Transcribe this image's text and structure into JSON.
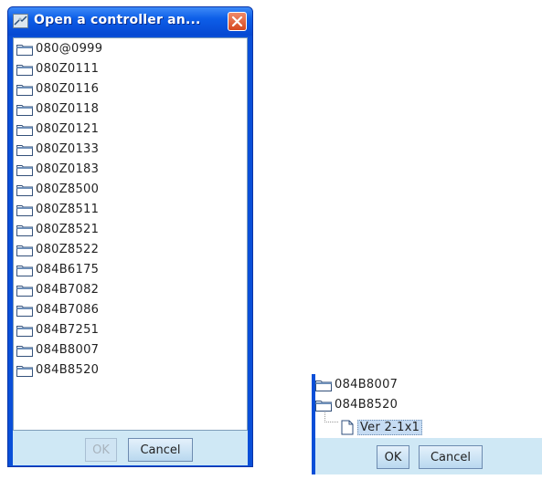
{
  "dialog": {
    "title": "Open a controller an...",
    "items": [
      "080@0999",
      "080Z0111",
      "080Z0116",
      "080Z0118",
      "080Z0121",
      "080Z0133",
      "080Z0183",
      "080Z8500",
      "080Z8511",
      "080Z8521",
      "080Z8522",
      "084B6175",
      "084B7082",
      "084B7086",
      "084B7251",
      "084B8007",
      "084B8520"
    ],
    "ok_label": "OK",
    "cancel_label": "Cancel",
    "ok_enabled": false
  },
  "expanded_view": {
    "items": [
      "084B8007",
      "084B8520"
    ],
    "child_label": "Ver 2-1x1",
    "ok_label": "OK",
    "cancel_label": "Cancel",
    "ok_enabled": true
  },
  "colors": {
    "title_bar": "#0a4fd8",
    "close_button": "#d6481f",
    "button_bar": "#cfe8f5",
    "selection": "#c6dcf3"
  },
  "icons": {
    "title": "controller-icon",
    "close": "close-icon",
    "tree_node": "folder-icon",
    "leaf": "document-icon"
  }
}
